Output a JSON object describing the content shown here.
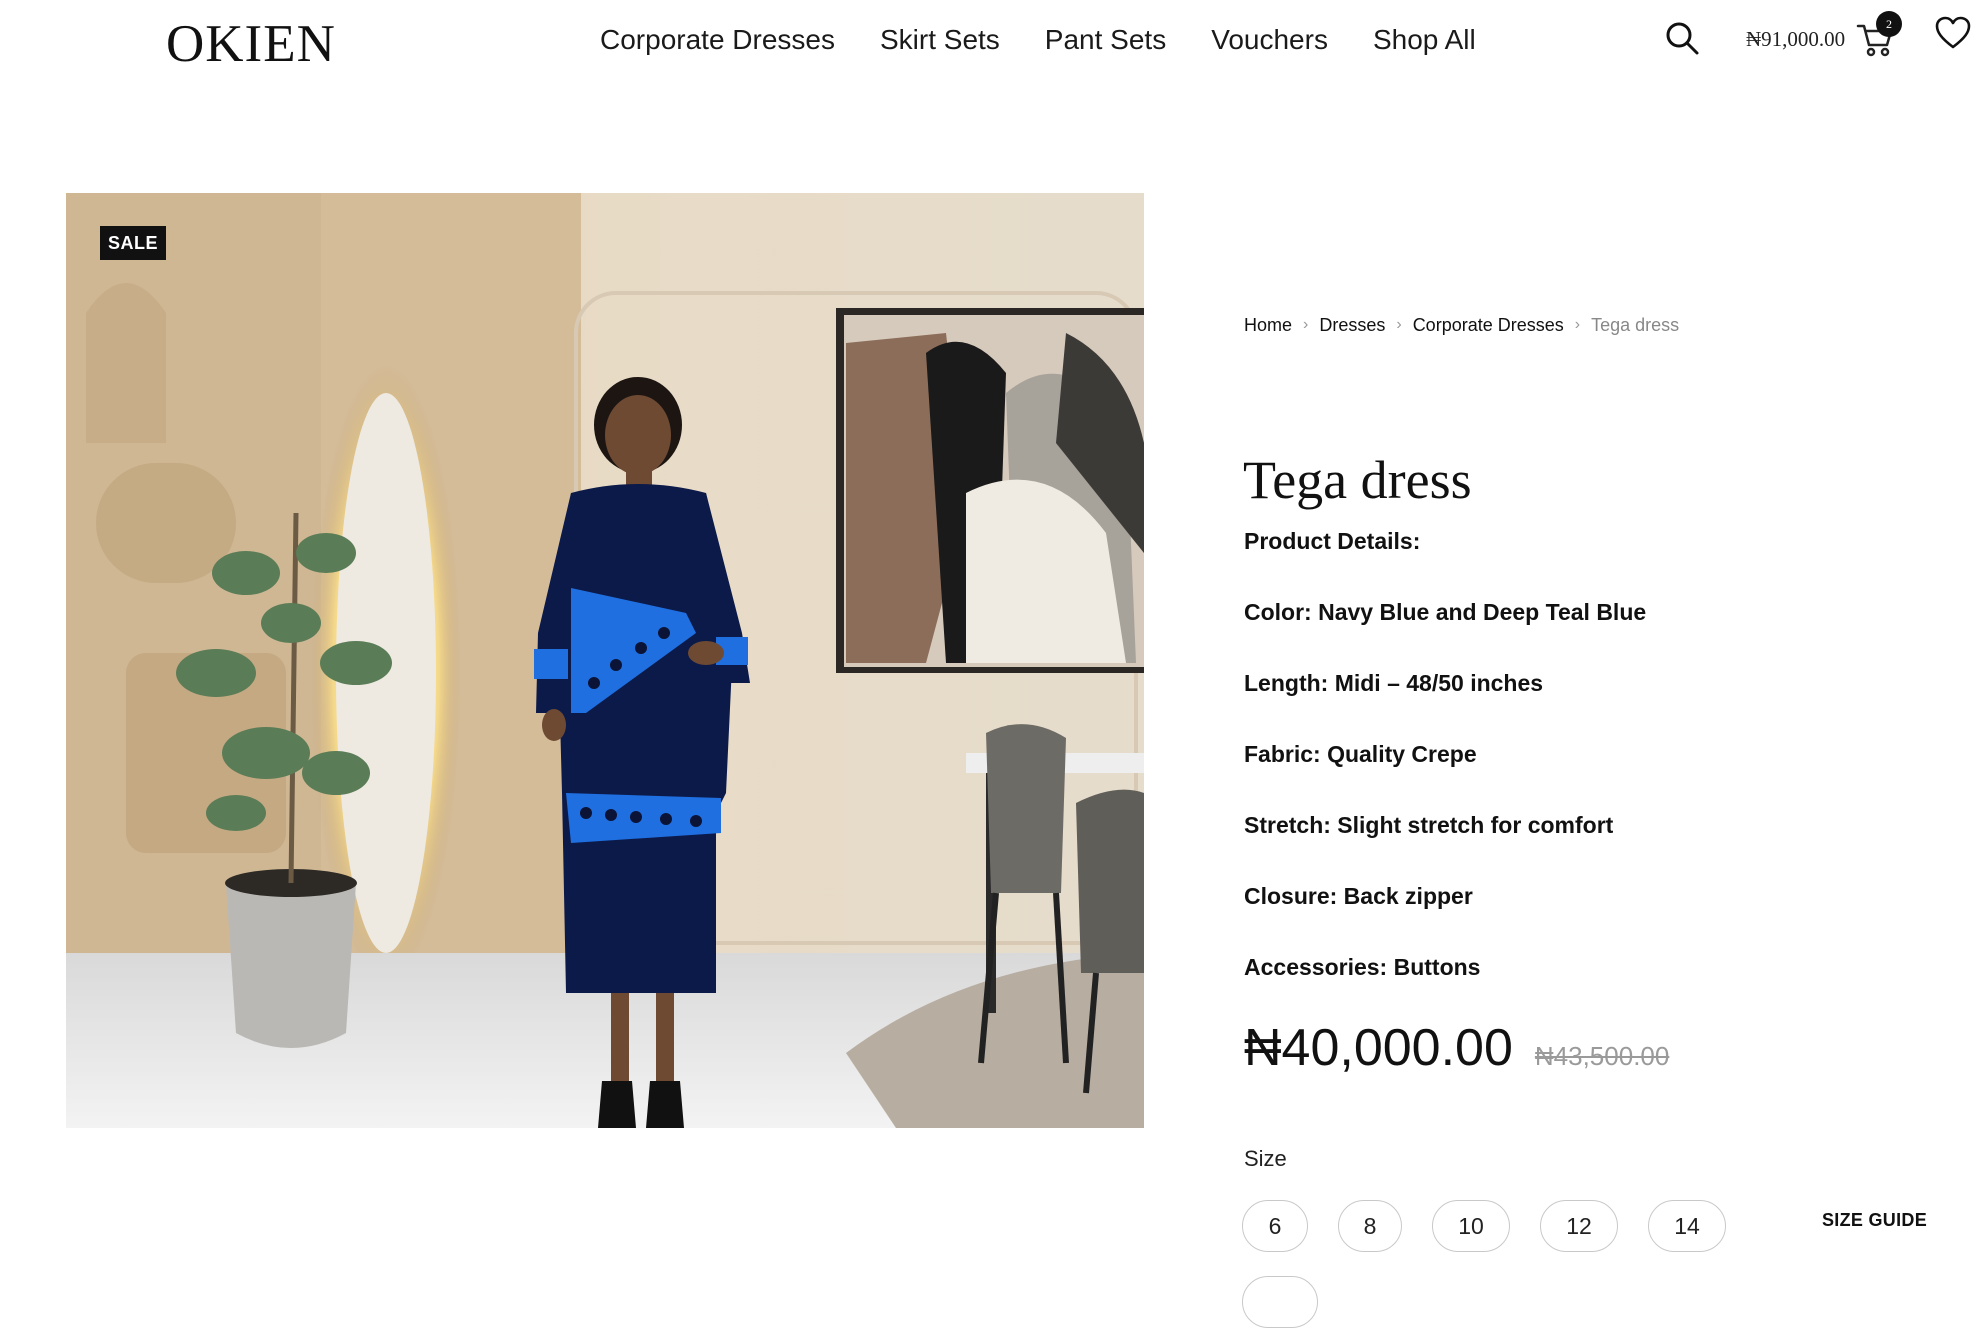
{
  "header": {
    "logo": "OKIEN",
    "nav": [
      "Corporate Dresses",
      "Skirt Sets",
      "Pant Sets",
      "Vouchers",
      "Shop All"
    ],
    "cart_total": "₦91,000.00",
    "cart_count": "2",
    "icons": [
      "search-icon",
      "cart-icon",
      "heart-icon"
    ]
  },
  "gallery": {
    "badge": "SALE"
  },
  "breadcrumb": {
    "items": [
      "Home",
      "Dresses",
      "Corporate Dresses",
      "Tega dress"
    ]
  },
  "product": {
    "title": "Tega dress",
    "details": [
      "Product Details:",
      "Color: Navy Blue and Deep Teal Blue",
      "Length: Midi – 48/50 inches",
      "Fabric: Quality Crepe",
      "Stretch: Slight stretch for comfort",
      "Closure: Back zipper",
      "Accessories: Buttons"
    ],
    "price_now": "₦40,000.00",
    "price_old": "₦43,500.00",
    "size_label": "Size",
    "sizes": [
      "6",
      "8",
      "10",
      "12",
      "14"
    ],
    "size_guide": "SIZE GUIDE"
  }
}
